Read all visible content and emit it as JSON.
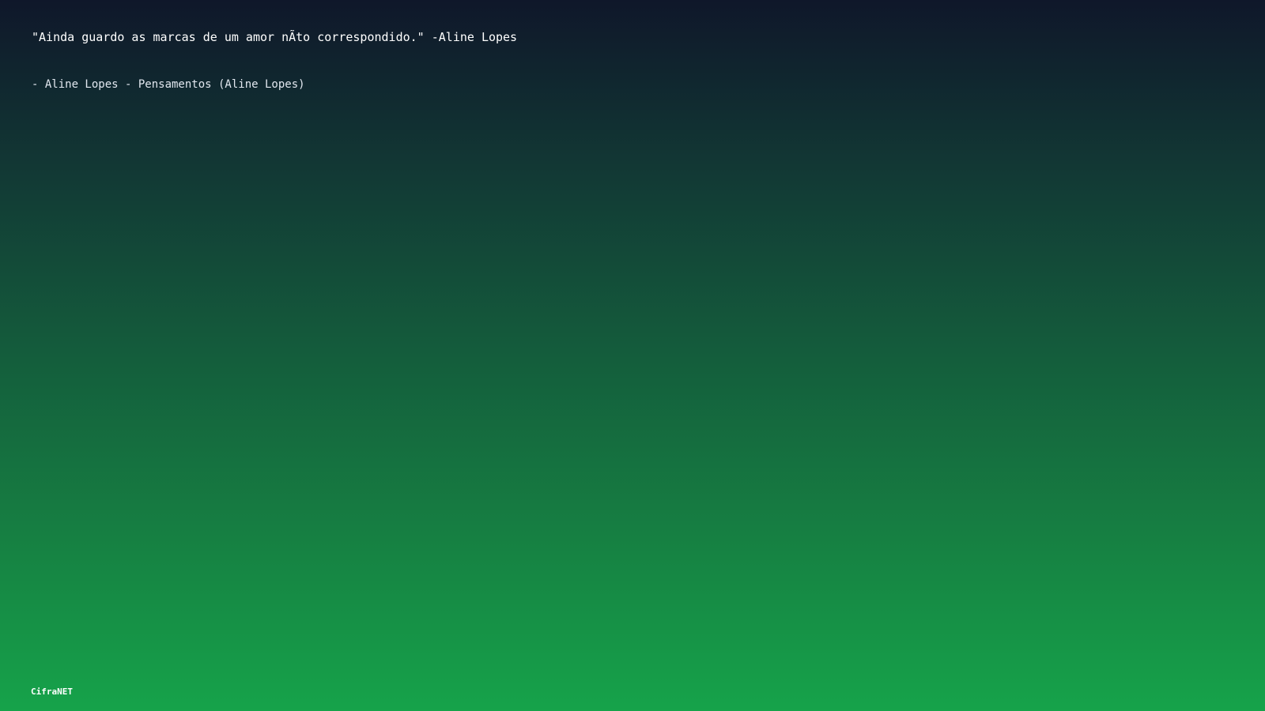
{
  "quote": {
    "text": "\"Ainda guardo as marcas de um amor nÃto correspondido.\" -Aline Lopes"
  },
  "attribution": {
    "text": "- Aline Lopes - Pensamentos (Aline Lopes)"
  },
  "footer": {
    "brand": "CifraNET"
  },
  "colors": {
    "gradient_top": "#0f172a",
    "gradient_bottom": "#16a34a",
    "text": "#ffffff"
  }
}
